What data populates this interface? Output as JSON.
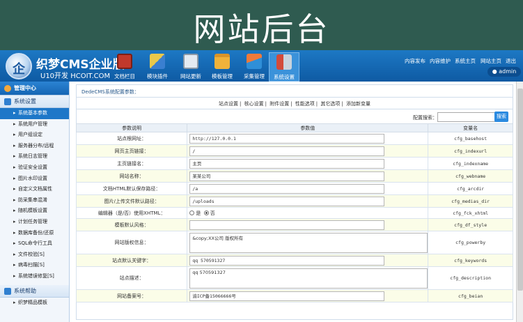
{
  "banner_title": "网站后台",
  "brand": {
    "logo_glyph": "企",
    "name": "织梦CMS企业版",
    "subtitle": "U10开发 HCOIT.COM"
  },
  "nav": [
    {
      "label": "文档栏目",
      "icon": "book-icon",
      "color": "#c0392b"
    },
    {
      "label": "模块插件",
      "icon": "ruler-pencil-icon",
      "color": "#d9b43a"
    },
    {
      "label": "网站更新",
      "icon": "printer-icon",
      "color": "#dfe6ee"
    },
    {
      "label": "模板管理",
      "icon": "folder-icon",
      "color": "#f0b23a"
    },
    {
      "label": "采集管理",
      "icon": "triangle-tools-icon",
      "color": "#e8663a"
    },
    {
      "label": "系统设置",
      "icon": "tools-icon",
      "color": "#d24a3a"
    }
  ],
  "top_links": [
    "内容发布",
    "内容维护",
    "系统主页",
    "网站主页",
    "退出"
  ],
  "user": "admin",
  "sidebar": {
    "main_title": "管理中心",
    "section1": "系统设置",
    "items": [
      "系统基本参数",
      "系统用户管理",
      "用户组设定",
      "服务器分布/远程",
      "系统日志管理",
      "验证安全设置",
      "图片水印设置",
      "自定义文档属性",
      "防采集串混淆",
      "随机模板设置",
      "计划任务管理",
      "数据库备份/还原",
      "SQL命令行工具",
      "文件校验[S]",
      "病毒扫描[S]",
      "系统错误修复[S]"
    ],
    "section2": "系统帮助",
    "help_items": [
      "织梦精品模板"
    ]
  },
  "config": {
    "title": "DedeCMS系统配置参数：",
    "tabs": [
      "站点设置",
      "核心设置",
      "附件设置",
      "性能选项",
      "其它选项",
      "添加新变量"
    ],
    "search_label": "配置搜索：",
    "search_value": "",
    "search_button": "搜索",
    "headers": [
      "参数说明",
      "参数值",
      "变量名"
    ],
    "rows": [
      {
        "label": "站点根网址：",
        "value": "http://127.0.0.1",
        "var": "cfg_basehost"
      },
      {
        "label": "网页主页链接：",
        "value": "/",
        "var": "cfg_indexurl"
      },
      {
        "label": "主页链接名：",
        "value": "主页",
        "var": "cfg_indexname"
      },
      {
        "label": "网站名称：",
        "value": "某某公司",
        "var": "cfg_webname"
      },
      {
        "label": "文档HTML默认保存路径：",
        "value": "/a",
        "var": "cfg_arcdir"
      },
      {
        "label": "图片/上传文件默认路径：",
        "value": "/uploads",
        "var": "cfg_medias_dir"
      },
      {
        "label": "编辑器（是/否）使用XHTML：",
        "radio_yes": "是",
        "radio_no": "否",
        "var": "cfg_fck_xhtml"
      },
      {
        "label": "模板默认风格：",
        "value": "",
        "var": "cfg_df_style"
      },
      {
        "label": "网站版权信息：",
        "value": "&copy;XX公司 版权所有",
        "var": "cfg_powerby"
      },
      {
        "label": "站点默认关键字：",
        "value": "qq 570591327",
        "var": "cfg_keywords"
      },
      {
        "label": "站点描述：",
        "value": "qq 570591327",
        "var": "cfg_description"
      },
      {
        "label": "网站备案号：",
        "value": "渝ICP备15066666号",
        "var": "cfg_beian"
      }
    ]
  }
}
